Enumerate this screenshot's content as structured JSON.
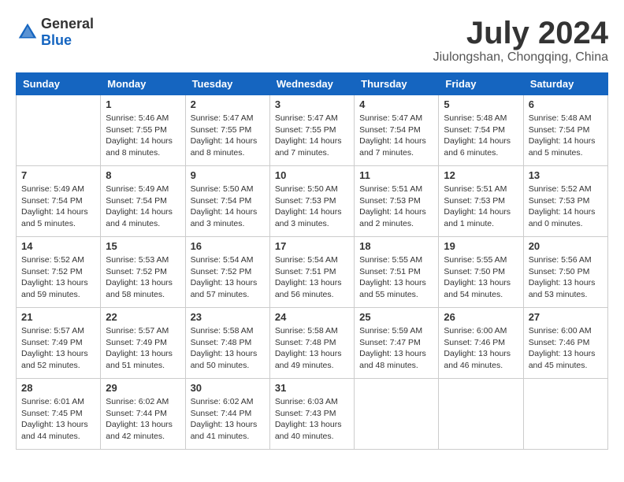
{
  "header": {
    "logo_general": "General",
    "logo_blue": "Blue",
    "month_title": "July 2024",
    "location": "Jiulongshan, Chongqing, China"
  },
  "calendar": {
    "weekdays": [
      "Sunday",
      "Monday",
      "Tuesday",
      "Wednesday",
      "Thursday",
      "Friday",
      "Saturday"
    ],
    "weeks": [
      [
        {
          "day": "",
          "data": ""
        },
        {
          "day": "1",
          "data": "Sunrise: 5:46 AM\nSunset: 7:55 PM\nDaylight: 14 hours\nand 8 minutes."
        },
        {
          "day": "2",
          "data": "Sunrise: 5:47 AM\nSunset: 7:55 PM\nDaylight: 14 hours\nand 8 minutes."
        },
        {
          "day": "3",
          "data": "Sunrise: 5:47 AM\nSunset: 7:55 PM\nDaylight: 14 hours\nand 7 minutes."
        },
        {
          "day": "4",
          "data": "Sunrise: 5:47 AM\nSunset: 7:54 PM\nDaylight: 14 hours\nand 7 minutes."
        },
        {
          "day": "5",
          "data": "Sunrise: 5:48 AM\nSunset: 7:54 PM\nDaylight: 14 hours\nand 6 minutes."
        },
        {
          "day": "6",
          "data": "Sunrise: 5:48 AM\nSunset: 7:54 PM\nDaylight: 14 hours\nand 5 minutes."
        }
      ],
      [
        {
          "day": "7",
          "data": "Sunrise: 5:49 AM\nSunset: 7:54 PM\nDaylight: 14 hours\nand 5 minutes."
        },
        {
          "day": "8",
          "data": "Sunrise: 5:49 AM\nSunset: 7:54 PM\nDaylight: 14 hours\nand 4 minutes."
        },
        {
          "day": "9",
          "data": "Sunrise: 5:50 AM\nSunset: 7:54 PM\nDaylight: 14 hours\nand 3 minutes."
        },
        {
          "day": "10",
          "data": "Sunrise: 5:50 AM\nSunset: 7:53 PM\nDaylight: 14 hours\nand 3 minutes."
        },
        {
          "day": "11",
          "data": "Sunrise: 5:51 AM\nSunset: 7:53 PM\nDaylight: 14 hours\nand 2 minutes."
        },
        {
          "day": "12",
          "data": "Sunrise: 5:51 AM\nSunset: 7:53 PM\nDaylight: 14 hours\nand 1 minute."
        },
        {
          "day": "13",
          "data": "Sunrise: 5:52 AM\nSunset: 7:53 PM\nDaylight: 14 hours\nand 0 minutes."
        }
      ],
      [
        {
          "day": "14",
          "data": "Sunrise: 5:52 AM\nSunset: 7:52 PM\nDaylight: 13 hours\nand 59 minutes."
        },
        {
          "day": "15",
          "data": "Sunrise: 5:53 AM\nSunset: 7:52 PM\nDaylight: 13 hours\nand 58 minutes."
        },
        {
          "day": "16",
          "data": "Sunrise: 5:54 AM\nSunset: 7:52 PM\nDaylight: 13 hours\nand 57 minutes."
        },
        {
          "day": "17",
          "data": "Sunrise: 5:54 AM\nSunset: 7:51 PM\nDaylight: 13 hours\nand 56 minutes."
        },
        {
          "day": "18",
          "data": "Sunrise: 5:55 AM\nSunset: 7:51 PM\nDaylight: 13 hours\nand 55 minutes."
        },
        {
          "day": "19",
          "data": "Sunrise: 5:55 AM\nSunset: 7:50 PM\nDaylight: 13 hours\nand 54 minutes."
        },
        {
          "day": "20",
          "data": "Sunrise: 5:56 AM\nSunset: 7:50 PM\nDaylight: 13 hours\nand 53 minutes."
        }
      ],
      [
        {
          "day": "21",
          "data": "Sunrise: 5:57 AM\nSunset: 7:49 PM\nDaylight: 13 hours\nand 52 minutes."
        },
        {
          "day": "22",
          "data": "Sunrise: 5:57 AM\nSunset: 7:49 PM\nDaylight: 13 hours\nand 51 minutes."
        },
        {
          "day": "23",
          "data": "Sunrise: 5:58 AM\nSunset: 7:48 PM\nDaylight: 13 hours\nand 50 minutes."
        },
        {
          "day": "24",
          "data": "Sunrise: 5:58 AM\nSunset: 7:48 PM\nDaylight: 13 hours\nand 49 minutes."
        },
        {
          "day": "25",
          "data": "Sunrise: 5:59 AM\nSunset: 7:47 PM\nDaylight: 13 hours\nand 48 minutes."
        },
        {
          "day": "26",
          "data": "Sunrise: 6:00 AM\nSunset: 7:46 PM\nDaylight: 13 hours\nand 46 minutes."
        },
        {
          "day": "27",
          "data": "Sunrise: 6:00 AM\nSunset: 7:46 PM\nDaylight: 13 hours\nand 45 minutes."
        }
      ],
      [
        {
          "day": "28",
          "data": "Sunrise: 6:01 AM\nSunset: 7:45 PM\nDaylight: 13 hours\nand 44 minutes."
        },
        {
          "day": "29",
          "data": "Sunrise: 6:02 AM\nSunset: 7:44 PM\nDaylight: 13 hours\nand 42 minutes."
        },
        {
          "day": "30",
          "data": "Sunrise: 6:02 AM\nSunset: 7:44 PM\nDaylight: 13 hours\nand 41 minutes."
        },
        {
          "day": "31",
          "data": "Sunrise: 6:03 AM\nSunset: 7:43 PM\nDaylight: 13 hours\nand 40 minutes."
        },
        {
          "day": "",
          "data": ""
        },
        {
          "day": "",
          "data": ""
        },
        {
          "day": "",
          "data": ""
        }
      ]
    ]
  }
}
